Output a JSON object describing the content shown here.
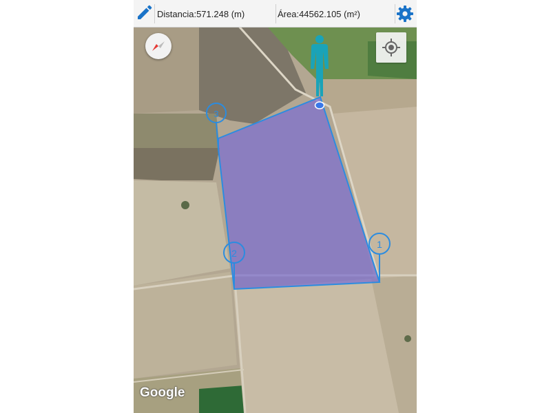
{
  "toolbar": {
    "distance_label": "Distancia:",
    "distance_value": "571.248",
    "distance_unit": "(m)",
    "area_label": "Área:",
    "area_value": "44562.105",
    "area_unit": "(m²)",
    "edit_icon": "pencil-icon",
    "settings_icon": "gear-icon",
    "accent_color": "#1a73c8"
  },
  "map": {
    "type": "satellite",
    "markers": [
      {
        "label": "1"
      },
      {
        "label": "2"
      },
      {
        "label": "3"
      }
    ],
    "polygon_fill": "#7b6fd0",
    "polygon_stroke": "#2b8ce0",
    "person_color": "#1aa3b8",
    "attribution": "Google",
    "compass_icon": "compass-icon",
    "locate_icon": "my-location-icon"
  }
}
